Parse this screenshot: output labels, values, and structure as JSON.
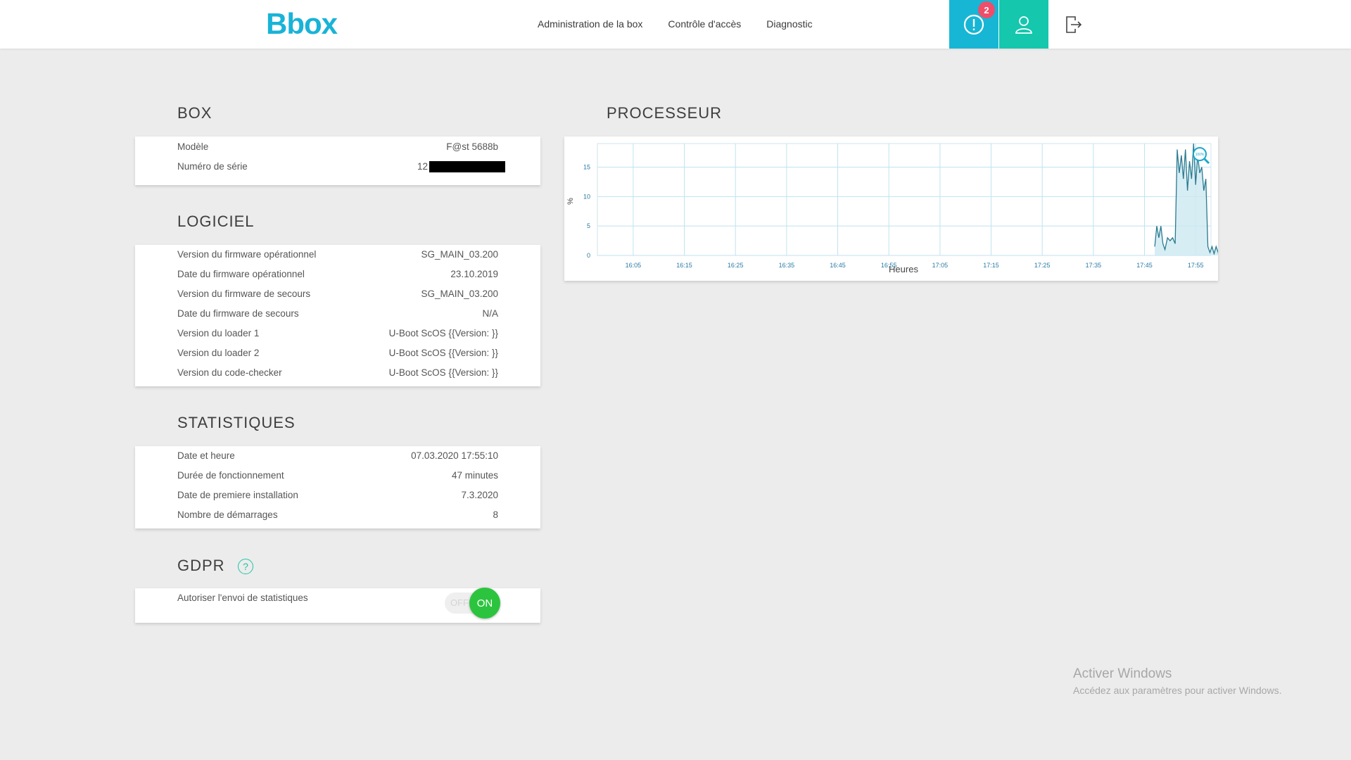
{
  "header": {
    "logo": "Bbox",
    "nav": [
      "Administration de la box",
      "Contrôle d'accès",
      "Diagnostic"
    ],
    "alert_count": "2"
  },
  "box": {
    "title": "BOX",
    "rows": [
      {
        "label": "Modèle",
        "value": "F@st 5688b"
      },
      {
        "label": "Numéro de série",
        "value": "12"
      }
    ]
  },
  "logiciel": {
    "title": "LOGICIEL",
    "rows": [
      {
        "label": "Version du firmware opérationnel",
        "value": "SG_MAIN_03.200"
      },
      {
        "label": "Date du firmware opérationnel",
        "value": "23.10.2019"
      },
      {
        "label": "Version du firmware de secours",
        "value": "SG_MAIN_03.200"
      },
      {
        "label": "Date du firmware de secours",
        "value": "N/A"
      },
      {
        "label": "Version du loader 1",
        "value": "U-Boot ScOS {{Version: }}"
      },
      {
        "label": "Version du loader 2",
        "value": "U-Boot ScOS {{Version: }}"
      },
      {
        "label": "Version du code-checker",
        "value": "U-Boot ScOS {{Version: }}"
      }
    ]
  },
  "statistiques": {
    "title": "STATISTIQUES",
    "rows": [
      {
        "label": "Date et heure",
        "value": "07.03.2020 17:55:10"
      },
      {
        "label": "Durée de fonctionnement",
        "value": "47 minutes"
      },
      {
        "label": "Date de premiere installation",
        "value": "7.3.2020"
      },
      {
        "label": "Nombre de démarrages",
        "value": "8"
      }
    ]
  },
  "gdpr": {
    "title": "GDPR",
    "help": "?",
    "row_label": "Autoriser l'envoi de statistiques",
    "toggle_off": "OFF",
    "toggle_on": "ON",
    "state": "on"
  },
  "processeur": {
    "title": "PROCESSEUR"
  },
  "chart_data": {
    "type": "area",
    "title": "",
    "xlabel": "Heures",
    "ylabel": "%",
    "x_ticks": [
      "16:05",
      "16:15",
      "16:25",
      "16:35",
      "16:45",
      "16:55",
      "17:05",
      "17:15",
      "17:25",
      "17:35",
      "17:45",
      "17:55"
    ],
    "y_ticks": [
      0,
      5,
      10,
      15
    ],
    "ylim": [
      0,
      19
    ],
    "xlim_minutes": [
      0,
      120
    ],
    "grid": true,
    "zoom_label": "100%",
    "series": [
      {
        "values": [
          [
            109,
            1.5
          ],
          [
            109.4,
            5
          ],
          [
            109.8,
            3
          ],
          [
            110.2,
            5
          ],
          [
            110.6,
            2
          ],
          [
            111,
            1
          ],
          [
            111.5,
            3
          ],
          [
            112,
            2.5
          ],
          [
            112.5,
            3
          ],
          [
            113,
            2
          ],
          [
            113.4,
            18
          ],
          [
            113.8,
            14
          ],
          [
            114.2,
            17
          ],
          [
            114.6,
            13
          ],
          [
            115,
            18
          ],
          [
            115.4,
            11
          ],
          [
            115.8,
            16
          ],
          [
            116.2,
            13
          ],
          [
            116.6,
            19
          ],
          [
            117,
            12
          ],
          [
            117.4,
            17
          ],
          [
            117.8,
            14
          ],
          [
            118.2,
            15
          ],
          [
            118.6,
            11
          ],
          [
            119,
            13
          ],
          [
            119.4,
            1.5
          ],
          [
            119.8,
            0.5
          ],
          [
            120.2,
            1.5
          ],
          [
            120.6,
            0.3
          ],
          [
            121,
            1.5
          ],
          [
            121.4,
            0.5
          ],
          [
            121.8,
            2
          ],
          [
            122.2,
            3
          ],
          [
            122.6,
            12
          ],
          [
            123,
            13
          ],
          [
            123.4,
            14
          ],
          [
            123.8,
            12.5
          ],
          [
            124.2,
            15
          ],
          [
            124.6,
            12
          ],
          [
            125,
            13
          ],
          [
            125.4,
            10
          ],
          [
            125.8,
            2.5
          ],
          [
            126.2,
            10
          ],
          [
            126.6,
            7
          ],
          [
            127,
            10
          ],
          [
            127.4,
            4
          ],
          [
            127.8,
            13
          ],
          [
            128.2,
            14
          ],
          [
            128.6,
            15
          ],
          [
            129,
            11
          ],
          [
            129.4,
            15
          ],
          [
            129.8,
            10
          ],
          [
            130.2,
            8
          ],
          [
            130.6,
            10
          ],
          [
            131,
            9
          ],
          [
            131.4,
            11
          ],
          [
            131.8,
            9
          ],
          [
            132.2,
            10
          ],
          [
            132.6,
            8.5
          ],
          [
            133,
            11.5
          ],
          [
            133.4,
            10
          ],
          [
            133.8,
            9
          ],
          [
            134.2,
            11
          ],
          [
            134.6,
            8.5
          ],
          [
            135,
            12
          ],
          [
            135.4,
            9
          ],
          [
            135.8,
            11
          ],
          [
            136.2,
            9.5
          ],
          [
            136.6,
            10.5
          ],
          [
            137,
            8.5
          ],
          [
            137.4,
            11
          ],
          [
            137.8,
            9
          ],
          [
            138.2,
            10.5
          ],
          [
            138.6,
            9
          ],
          [
            139,
            11
          ],
          [
            139.4,
            8.5
          ],
          [
            139.8,
            10
          ],
          [
            140.2,
            9.5
          ],
          [
            140.6,
            11
          ],
          [
            141,
            9
          ],
          [
            141.4,
            10.5
          ],
          [
            141.8,
            8.5
          ],
          [
            142.2,
            10
          ],
          [
            142.6,
            9.5
          ],
          [
            143,
            11
          ],
          [
            143.4,
            9
          ],
          [
            143.8,
            10
          ],
          [
            144.2,
            9
          ],
          [
            144.6,
            11
          ],
          [
            145,
            8.5
          ],
          [
            145.4,
            10.5
          ],
          [
            145.8,
            9
          ],
          [
            146.2,
            17
          ],
          [
            146.6,
            11
          ],
          [
            147,
            15.5
          ],
          [
            147.4,
            10
          ],
          [
            147.8,
            16
          ],
          [
            148.2,
            9
          ],
          [
            148.6,
            10.5
          ],
          [
            149,
            12
          ]
        ]
      }
    ]
  },
  "watermark": {
    "line1": "Activer Windows",
    "line2": "Accédez aux paramètres pour activer Windows."
  }
}
